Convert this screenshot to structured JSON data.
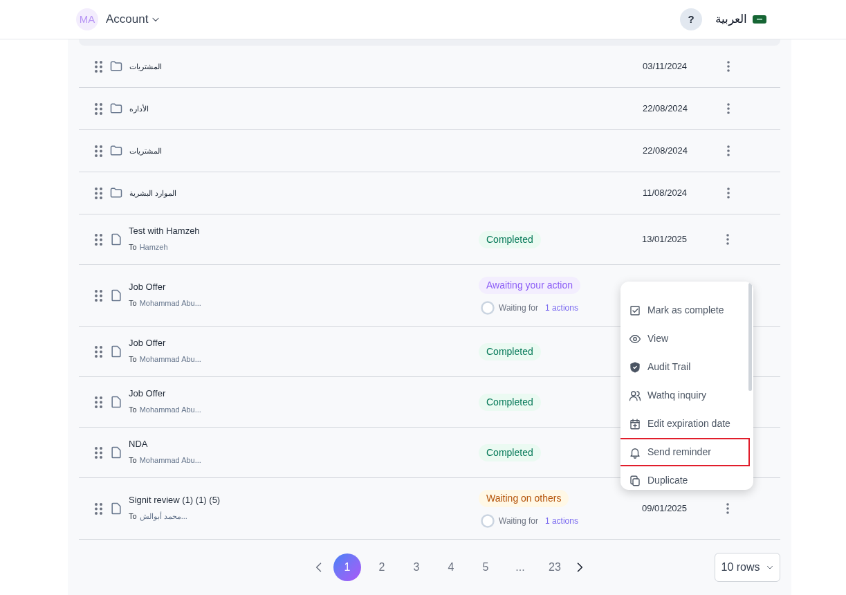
{
  "header": {
    "avatar": "MA",
    "account": "Account",
    "help": "?",
    "language": "العربية"
  },
  "rows": [
    {
      "kind": "folder",
      "title": "المشتريات",
      "date": "03/11/2024"
    },
    {
      "kind": "folder",
      "title": "الأداره",
      "date": "22/08/2024"
    },
    {
      "kind": "folder",
      "title": "المشتريات",
      "date": "22/08/2024"
    },
    {
      "kind": "folder",
      "title": "الموارد البشرية",
      "date": "11/08/2024"
    },
    {
      "kind": "document",
      "title": "Test with Hamzeh",
      "to_label": "To",
      "recipient": "Hamzeh",
      "status": {
        "kind": "completed",
        "label": "Completed"
      },
      "date": "13/01/2025"
    },
    {
      "kind": "document",
      "title": "Job Offer",
      "to_label": "To",
      "recipient": "Mohammad Abu...",
      "status": {
        "kind": "awaiting",
        "label": "Awaiting your action"
      },
      "waiting": {
        "label": "Waiting for",
        "count": "1 actions"
      }
    },
    {
      "kind": "document",
      "title": "Job Offer",
      "to_label": "To",
      "recipient": "Mohammad Abu...",
      "status": {
        "kind": "completed",
        "label": "Completed"
      }
    },
    {
      "kind": "document",
      "title": "Job Offer",
      "to_label": "To",
      "recipient": "Mohammad Abu...",
      "status": {
        "kind": "completed",
        "label": "Completed"
      }
    },
    {
      "kind": "document",
      "title": "NDA",
      "to_label": "To",
      "recipient": "Mohammad Abu...",
      "status": {
        "kind": "completed",
        "label": "Completed"
      }
    },
    {
      "kind": "document",
      "title": "Signit review (1) (1) (5)",
      "to_label": "To",
      "recipient": "محمد أبوالش...",
      "status": {
        "kind": "waiting_others",
        "label": "Waiting on others"
      },
      "waiting": {
        "label": "Waiting for",
        "count": "1 actions"
      },
      "date": "09/01/2025"
    }
  ],
  "context_menu": [
    {
      "kind": "check",
      "label": "Mark as complete",
      "selected": false
    },
    {
      "kind": "eye",
      "label": "View",
      "selected": false
    },
    {
      "kind": "shield",
      "label": "Audit Trail",
      "selected": false
    },
    {
      "kind": "users",
      "label": "Wathq inquiry",
      "selected": false
    },
    {
      "kind": "calendar",
      "label": "Edit expiration date",
      "selected": false
    },
    {
      "kind": "bell",
      "label": "Send reminder",
      "selected": true
    },
    {
      "kind": "copy",
      "label": "Duplicate",
      "selected": false
    }
  ],
  "pagination": {
    "pages": [
      {
        "label": "1",
        "selected": true
      },
      {
        "label": "2",
        "selected": false
      },
      {
        "label": "3",
        "selected": false
      },
      {
        "label": "4",
        "selected": false
      },
      {
        "label": "5",
        "selected": false
      },
      {
        "label": "...",
        "selected": false
      },
      {
        "label": "23",
        "selected": false
      }
    ],
    "rows_per_page": "10 rows"
  }
}
